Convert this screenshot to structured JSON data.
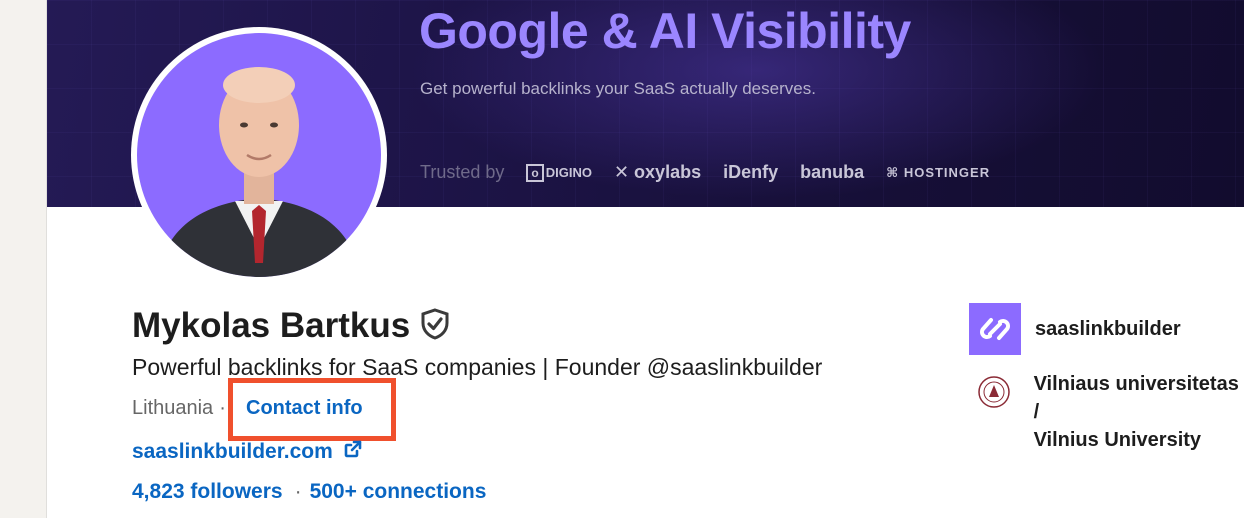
{
  "banner": {
    "title": "Google & AI Visibility",
    "subtitle": "Get powerful backlinks your SaaS actually deserves.",
    "trusted_label": "Trusted by",
    "brands": [
      "DIGINO",
      "oxylabs",
      "iDenfy",
      "banuba",
      "HOSTINGER"
    ]
  },
  "profile": {
    "name": "Mykolas Bartkus",
    "headline": "Powerful backlinks for SaaS companies | Founder @saaslinkbuilder",
    "location": "Lithuania",
    "separator": "·",
    "contact_label": "Contact info",
    "website": "saaslinkbuilder.com",
    "followers": "4,823 followers",
    "connections": "500+ connections"
  },
  "organizations": [
    {
      "name": "saaslinkbuilder",
      "icon": "link-logo-icon"
    },
    {
      "name_line1": "Vilniaus universitetas /",
      "name_line2": "Vilnius University",
      "icon": "university-seal-icon"
    }
  ],
  "colors": {
    "link_blue": "#0a66c2",
    "highlight": "#f0502d",
    "brand_purple": "#8c6bff",
    "banner_dark": "#1d1447"
  }
}
